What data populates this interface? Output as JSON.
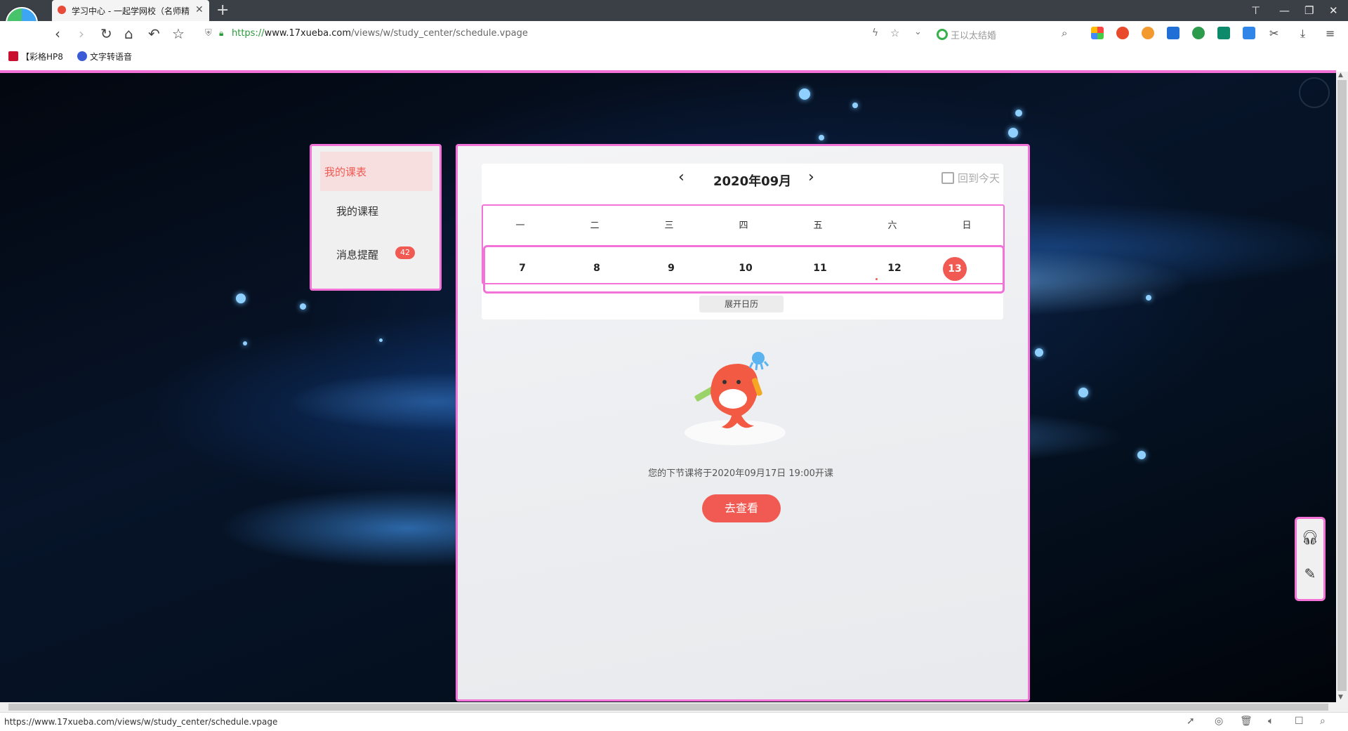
{
  "browser": {
    "tab_title": "学习中心 - 一起学网校（名师精",
    "new_tab": "+",
    "url_https": "https://",
    "url_host": "www.17xueba.com",
    "url_path": "/views/w/study_center/schedule.vpage",
    "search_placeholder": "王以太结婚",
    "bookmarks": [
      "【彩格HP8",
      "文字转语音"
    ],
    "status_url": "https://www.17xueba.com/views/w/study_center/schedule.vpage"
  },
  "sidebar": {
    "items": [
      {
        "label": "我的课表",
        "active": true
      },
      {
        "label": "我的课程"
      },
      {
        "label": "消息提醒",
        "badge": "42"
      }
    ]
  },
  "calendar": {
    "month_title": "2020年09月",
    "back_today": "回到今天",
    "weekdays": [
      "一",
      "二",
      "三",
      "四",
      "五",
      "六",
      "日"
    ],
    "days": [
      "7",
      "8",
      "9",
      "10",
      "11",
      "12",
      "13"
    ],
    "today": "13",
    "expand_label": "展开日历"
  },
  "next_class": {
    "text": "您的下节课将于2020年09月17日 19:00开课",
    "button": "去查看"
  },
  "colors": {
    "accent": "#f15a52",
    "highlight_border": "#f272d8"
  }
}
